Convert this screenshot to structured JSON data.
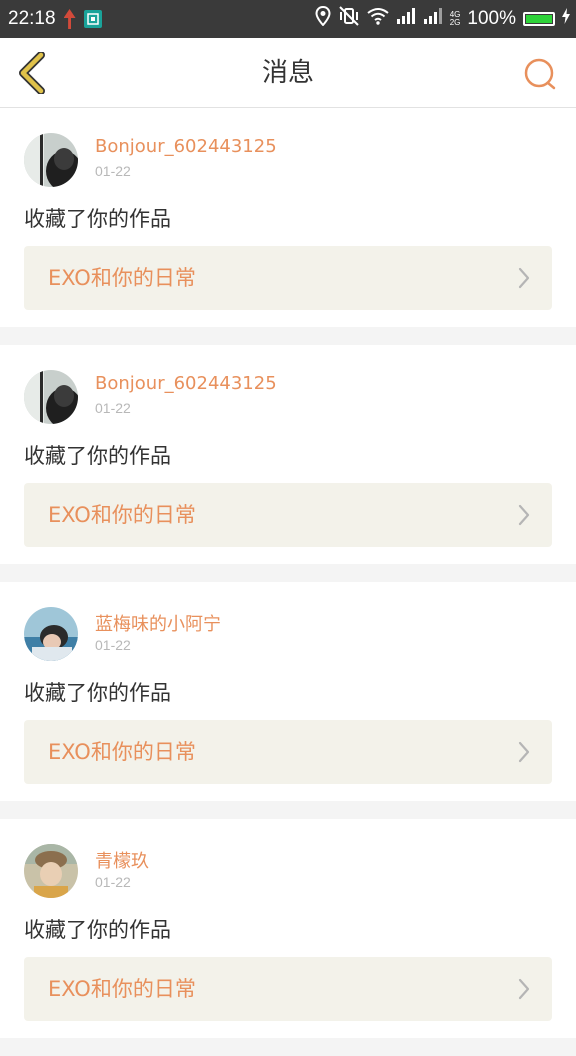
{
  "status_bar": {
    "time": "22:18",
    "battery": "100%",
    "battery_level": 1.0,
    "network_top": "4G",
    "network_bottom": "2G"
  },
  "header": {
    "title": "消息",
    "back_icon": "chevron-left-icon",
    "search_icon": "search-icon"
  },
  "colors": {
    "accent": "#e8905c",
    "back_icon": "#e0c24a",
    "status_bar": "#3a3a3a",
    "card_link_bg": "#f3f2ea"
  },
  "messages": [
    {
      "username": "Bonjour_602443125",
      "date": "01-22",
      "action": "收藏了你的作品",
      "work_title": "EXO和你的日常"
    },
    {
      "username": "Bonjour_602443125",
      "date": "01-22",
      "action": "收藏了你的作品",
      "work_title": "EXO和你的日常"
    },
    {
      "username": "蓝梅味的小阿宁",
      "date": "01-22",
      "action": "收藏了你的作品",
      "work_title": "EXO和你的日常"
    },
    {
      "username": "青檬玖",
      "date": "01-22",
      "action": "收藏了你的作品",
      "work_title": "EXO和你的日常"
    }
  ]
}
